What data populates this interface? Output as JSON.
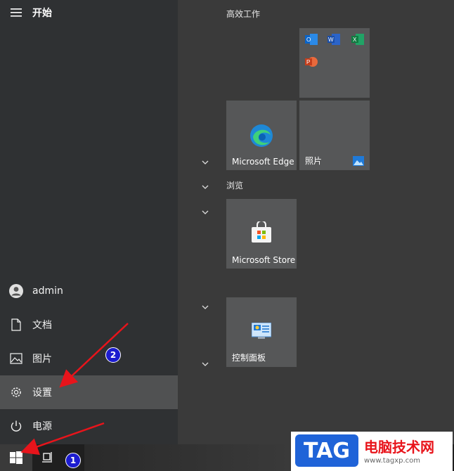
{
  "start_menu": {
    "title": "开始",
    "nav": {
      "user": "admin",
      "documents": "文档",
      "pictures": "图片",
      "settings": "设置",
      "power": "电源"
    }
  },
  "tiles": {
    "group1_title": "高效工作",
    "group2_title": "浏览",
    "edge_label": "Microsoft Edge",
    "photos_label": "照片",
    "store_label": "Microsoft Store",
    "control_panel_label": "控制面板"
  },
  "annotations": {
    "badge1": "1",
    "badge2": "2"
  },
  "watermark": {
    "tag": "TAG",
    "text": "电脑技术网",
    "url": "www.tagxp.com"
  },
  "colors": {
    "accent_red": "#e8141b",
    "badge_blue": "#1c1ccf"
  }
}
